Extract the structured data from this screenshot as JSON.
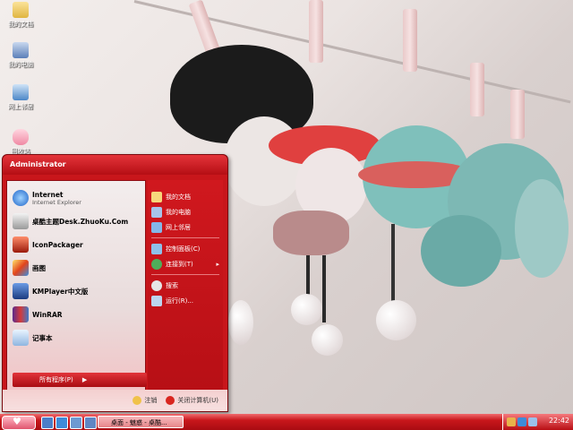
{
  "desktop": {
    "icons": [
      {
        "label": "我的文档"
      },
      {
        "label": "我的电脑"
      },
      {
        "label": "网上邻居"
      },
      {
        "label": "回收站"
      }
    ]
  },
  "start_menu": {
    "user_name": "Administrator",
    "programs": [
      {
        "title": "Internet",
        "subtitle": "Internet Explorer",
        "icon": "internet-explorer-icon"
      },
      {
        "title": "桌酷主题Desk.ZhuoKu.Com",
        "subtitle": "",
        "icon": "zhuoku-icon"
      },
      {
        "title": "IconPackager",
        "subtitle": "",
        "icon": "iconpackager-icon"
      },
      {
        "title": "画图",
        "subtitle": "",
        "icon": "paint-icon"
      },
      {
        "title": "KMPlayer中文版",
        "subtitle": "",
        "icon": "kmplayer-icon"
      },
      {
        "title": "WinRAR",
        "subtitle": "",
        "icon": "winrar-icon"
      },
      {
        "title": "记事本",
        "subtitle": "",
        "icon": "notepad-icon"
      }
    ],
    "all_programs": "所有程序(P)",
    "right_items": [
      {
        "label": "我的文档",
        "icon": "documents-icon"
      },
      {
        "label": "我的电脑",
        "icon": "computer-icon"
      },
      {
        "label": "网上邻居",
        "icon": "network-icon"
      },
      {
        "label": "控制面板(C)",
        "icon": "control-panel-icon"
      },
      {
        "label": "连接到(T)",
        "icon": "connect-icon"
      },
      {
        "label": "搜索",
        "icon": "search-icon"
      },
      {
        "label": "运行(R)...",
        "icon": "run-icon"
      }
    ],
    "logoff": "注销",
    "shutdown": "关闭计算机(U)"
  },
  "taskbar": {
    "task_label": "桌面 - 魅惑 - 桌酷...",
    "clock": "22:42"
  },
  "colors": {
    "accent": "#c8161b",
    "menu_panel": "#f3eded"
  }
}
